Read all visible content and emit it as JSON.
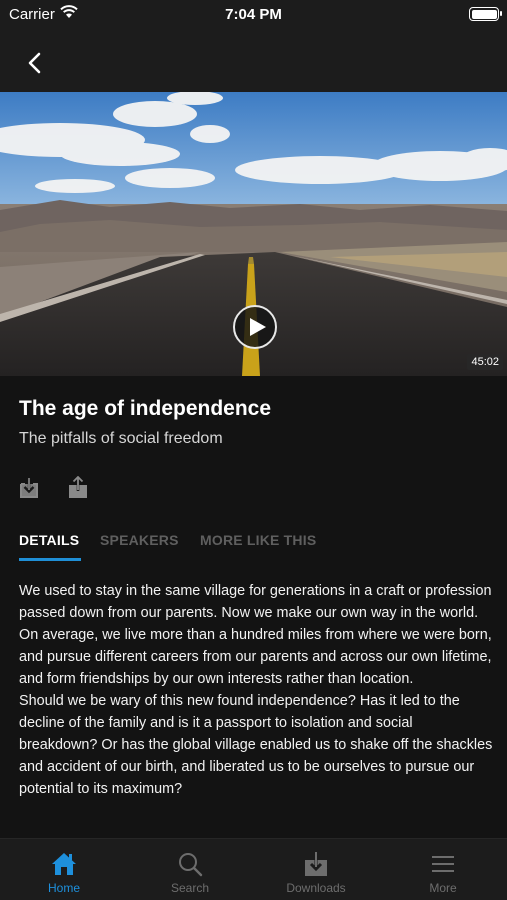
{
  "status_bar": {
    "carrier": "Carrier",
    "time": "7:04 PM"
  },
  "nav": {
    "back_icon": "chevron-left-icon"
  },
  "video": {
    "duration": "45:02",
    "play_icon": "play-icon"
  },
  "episode": {
    "title": "The age of independence",
    "subtitle": "The pitfalls of social freedom"
  },
  "actions": [
    {
      "name": "download-icon"
    },
    {
      "name": "share-icon"
    }
  ],
  "tabs": [
    {
      "label": "DETAILS",
      "active": true
    },
    {
      "label": "SPEAKERS",
      "active": false
    },
    {
      "label": "MORE LIKE THIS",
      "active": false
    }
  ],
  "details": {
    "paragraph1": "We used to stay in the same village for generations in a craft or profession passed down from our parents. Now we make our own way in the world. On average, we live more than a hundred miles from where we were born, and pursue different careers from our parents and across our own lifetime, and form friendships by our own interests rather than location.",
    "paragraph2": "Should we be wary of this new found independence? Has it led to the decline of the family and is it a passport to isolation and social breakdown? Or has the global village enabled us to shake off the shackles and accident of our birth, and liberated us to be ourselves to pursue our potential to its maximum?"
  },
  "tab_bar": [
    {
      "label": "Home",
      "icon": "home-icon",
      "active": true
    },
    {
      "label": "Search",
      "icon": "search-icon",
      "active": false
    },
    {
      "label": "Downloads",
      "icon": "downloads-icon",
      "active": false
    },
    {
      "label": "More",
      "icon": "menu-icon",
      "active": false
    }
  ],
  "colors": {
    "accent": "#1f8fd6",
    "background": "#131313",
    "bar": "#1c1c1c"
  }
}
